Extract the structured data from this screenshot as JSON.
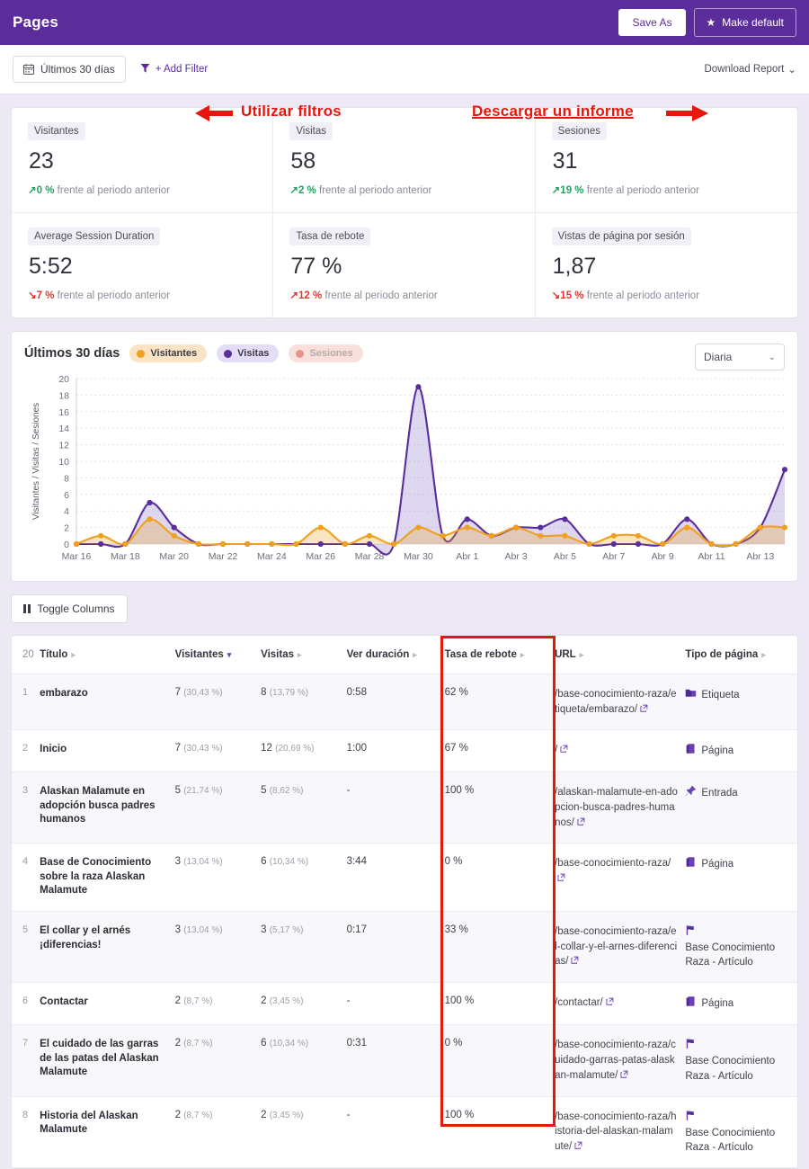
{
  "topbar": {
    "title": "Pages",
    "save_as_label": "Save As",
    "make_default_label": "Make default",
    "star_icon": "star-icon",
    "bg_color": "#5b2d9a"
  },
  "filterbar": {
    "date_range_label": "Últimos 30 días",
    "calendar_icon": "calendar-icon",
    "add_filter_label": "+ Add Filter",
    "filter_icon": "funnel-icon",
    "download_report_label": "Download Report",
    "download_chevron": "⌄"
  },
  "annotations": [
    {
      "text": "Utilizar filtros",
      "color": "#e8160c",
      "points_to": "add-filter-link"
    },
    {
      "text": "Descargar un informe",
      "color": "#e8160c",
      "points_to": "download-report-link"
    }
  ],
  "stats": [
    {
      "label": "Visitantes",
      "value": "23",
      "delta": "0 %",
      "direction": "up",
      "delta_color": "#22a463",
      "suffix": "frente al periodo anterior"
    },
    {
      "label": "Visitas",
      "value": "58",
      "delta": "2 %",
      "direction": "up",
      "delta_color": "#22a463",
      "suffix": "frente al periodo anterior"
    },
    {
      "label": "Sesiones",
      "value": "31",
      "delta": "19 %",
      "direction": "up",
      "delta_color": "#22a463",
      "suffix": "frente al periodo anterior"
    },
    {
      "label": "Average Session Duration",
      "value": "5:52",
      "delta": "7 %",
      "direction": "down",
      "delta_color": "#e0372f",
      "suffix": "frente al periodo anterior"
    },
    {
      "label": "Tasa de rebote",
      "value": "77 %",
      "delta": "12 %",
      "direction": "up",
      "delta_color": "#e0372f",
      "suffix": "frente al periodo anterior"
    },
    {
      "label": "Vistas de página por sesión",
      "value": "1,87",
      "delta": "15 %",
      "direction": "down",
      "delta_color": "#e0372f",
      "suffix": "frente al periodo anterior"
    }
  ],
  "chart_card": {
    "title": "Últimos 30 días",
    "period_selected": "Diaria",
    "period_options": [
      "Diaria"
    ]
  },
  "chart_data": {
    "type": "area",
    "title": "Últimos 30 días",
    "xlabel": "",
    "ylabel": "Visitantes / Visitas / Sesiones",
    "ylim": [
      0,
      20
    ],
    "yticks": [
      0,
      2,
      4,
      6,
      8,
      10,
      12,
      14,
      16,
      18,
      20
    ],
    "grid": true,
    "legend_position": "top",
    "x": [
      "Mar 16",
      "Mar 17",
      "Mar 18",
      "Mar 19",
      "Mar 20",
      "Mar 21",
      "Mar 22",
      "Mar 23",
      "Mar 24",
      "Mar 25",
      "Mar 26",
      "Mar 27",
      "Mar 28",
      "Mar 29",
      "Mar 30",
      "Mar 31",
      "Abr 1",
      "Abr 2",
      "Abr 3",
      "Abr 4",
      "Abr 5",
      "Abr 6",
      "Abr 7",
      "Abr 8",
      "Abr 9",
      "Abr 10",
      "Abr 11",
      "Abr 12",
      "Abr 13",
      "Abr 14"
    ],
    "xtick_labels": [
      "Mar 16",
      "Mar 18",
      "Mar 20",
      "Mar 22",
      "Mar 24",
      "Mar 26",
      "Mar 28",
      "Mar 30",
      "Abr 1",
      "Abr 3",
      "Abr 5",
      "Abr 7",
      "Abr 9",
      "Abr 11",
      "Abr 13"
    ],
    "series": [
      {
        "name": "Visitantes",
        "color": "#f0a020",
        "active": true,
        "values": [
          0,
          1,
          0,
          3,
          1,
          0,
          0,
          0,
          0,
          0,
          2,
          0,
          1,
          0,
          2,
          1,
          2,
          1,
          2,
          1,
          1,
          0,
          1,
          1,
          0,
          2,
          0,
          0,
          2,
          2
        ]
      },
      {
        "name": "Visitas",
        "color": "#5b2d9a",
        "active": true,
        "values": [
          0,
          0,
          0,
          5,
          2,
          0,
          0,
          0,
          0,
          0,
          0,
          0,
          0,
          0,
          19,
          1,
          3,
          1,
          2,
          2,
          3,
          0,
          0,
          0,
          0,
          3,
          0,
          0,
          2,
          9
        ]
      },
      {
        "name": "Sesiones",
        "color": "#e89289",
        "active": false,
        "values": []
      }
    ]
  },
  "toolbar": {
    "toggle_columns_label": "Toggle Columns",
    "columns_icon": "columns-icon"
  },
  "table": {
    "row_count_badge": "20",
    "headers": [
      {
        "label": "Título",
        "sorted": false
      },
      {
        "label": "Visitantes",
        "sorted": true
      },
      {
        "label": "Visitas",
        "sorted": false
      },
      {
        "label": "Ver duración",
        "sorted": false
      },
      {
        "label": "Tasa de rebote",
        "sorted": false
      },
      {
        "label": "URL",
        "sorted": false
      },
      {
        "label": "Tipo de página",
        "sorted": false
      }
    ],
    "highlight_column": "Tasa de rebote",
    "highlight_color": "#e8160c",
    "rows": [
      {
        "rank": "1",
        "title": "embarazo",
        "visitantes": "7",
        "visitantes_pct": "(30,43 %)",
        "visitas": "8",
        "visitas_pct": "(13,79 %)",
        "duracion": "0:58",
        "rebote": "62 %",
        "url": "/base-conocimiento-raza/etiqueta/embarazo/",
        "tipo": "Etiqueta",
        "tipo_icon": "folder-icon"
      },
      {
        "rank": "2",
        "title": "Inicio",
        "visitantes": "7",
        "visitantes_pct": "(30,43 %)",
        "visitas": "12",
        "visitas_pct": "(20,69 %)",
        "duracion": "1:00",
        "rebote": "67 %",
        "url": "/",
        "tipo": "Página",
        "tipo_icon": "book-icon"
      },
      {
        "rank": "3",
        "title": "Alaskan Malamute en adopción busca padres humanos",
        "visitantes": "5",
        "visitantes_pct": "(21,74 %)",
        "visitas": "5",
        "visitas_pct": "(8,62 %)",
        "duracion": "-",
        "rebote": "100 %",
        "url": "/alaskan-malamute-en-adopcion-busca-padres-humanos/",
        "tipo": "Entrada",
        "tipo_icon": "pushpin-icon"
      },
      {
        "rank": "4",
        "title": "Base de Conocimiento sobre la raza Alaskan Malamute",
        "visitantes": "3",
        "visitantes_pct": "(13,04 %)",
        "visitas": "6",
        "visitas_pct": "(10,34 %)",
        "duracion": "3:44",
        "rebote": "0 %",
        "url": "/base-conocimiento-raza/",
        "tipo": "Página",
        "tipo_icon": "book-icon"
      },
      {
        "rank": "5",
        "title": "El collar y el arnés ¡diferencias!",
        "visitantes": "3",
        "visitantes_pct": "(13,04 %)",
        "visitas": "3",
        "visitas_pct": "(5,17 %)",
        "duracion": "0:17",
        "rebote": "33 %",
        "url": "/base-conocimiento-raza/el-collar-y-el-arnes-diferencias/",
        "tipo": "Base Conocimiento Raza - Artículo",
        "tipo_icon": "flag-icon"
      },
      {
        "rank": "6",
        "title": "Contactar",
        "visitantes": "2",
        "visitantes_pct": "(8,7 %)",
        "visitas": "2",
        "visitas_pct": "(3,45 %)",
        "duracion": "-",
        "rebote": "100 %",
        "url": "/contactar/",
        "tipo": "Página",
        "tipo_icon": "book-icon"
      },
      {
        "rank": "7",
        "title": "El cuidado de las garras de las patas del Alaskan Malamute",
        "visitantes": "2",
        "visitantes_pct": "(8,7 %)",
        "visitas": "6",
        "visitas_pct": "(10,34 %)",
        "duracion": "0:31",
        "rebote": "0 %",
        "url": "/base-conocimiento-raza/cuidado-garras-patas-alaskan-malamute/",
        "tipo": "Base Conocimiento Raza - Artículo",
        "tipo_icon": "flag-icon"
      },
      {
        "rank": "8",
        "title": "Historia del Alaskan Malamute",
        "visitantes": "2",
        "visitantes_pct": "(8,7 %)",
        "visitas": "2",
        "visitas_pct": "(3,45 %)",
        "duracion": "-",
        "rebote": "100 %",
        "url": "/base-conocimiento-raza/historia-del-alaskan-malamute/",
        "tipo": "Base Conocimiento Raza - Artículo",
        "tipo_icon": "flag-icon"
      }
    ]
  }
}
